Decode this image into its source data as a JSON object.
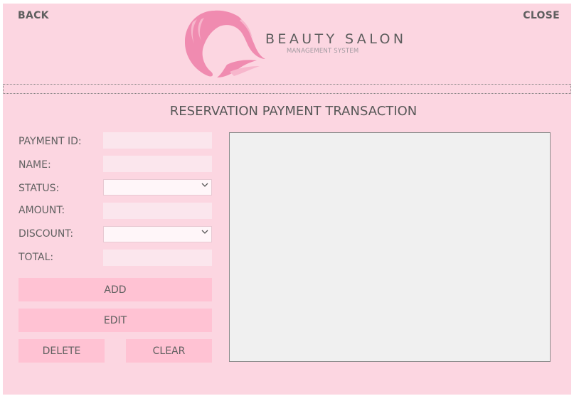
{
  "nav": {
    "back_label": "BACK",
    "close_label": "CLOSE"
  },
  "brand": {
    "title": "BEAUTY SALON",
    "subtitle": "MANAGEMENT SYSTEM"
  },
  "section": {
    "title": "RESERVATION PAYMENT TRANSACTION"
  },
  "form": {
    "payment_id_label": "PAYMENT ID:",
    "name_label": "NAME:",
    "status_label": "STATUS:",
    "amount_label": "AMOUNT:",
    "discount_label": "DISCOUNT:",
    "total_label": "TOTAL:",
    "payment_id_value": "",
    "name_value": "",
    "status_value": "",
    "amount_value": "",
    "discount_value": "",
    "total_value": ""
  },
  "actions": {
    "add_label": "ADD",
    "edit_label": "EDIT",
    "delete_label": "DELETE",
    "clear_label": "CLEAR"
  },
  "icons": {
    "logo": "woman-silhouette-logo-icon",
    "dropdown": "chevron-down-icon"
  },
  "colors": {
    "background": "#fcd6e1",
    "button": "#ffc2d3",
    "textbox": "#fbe6ed",
    "logo": "#f08bb0",
    "grid": "#f0f0f0"
  }
}
